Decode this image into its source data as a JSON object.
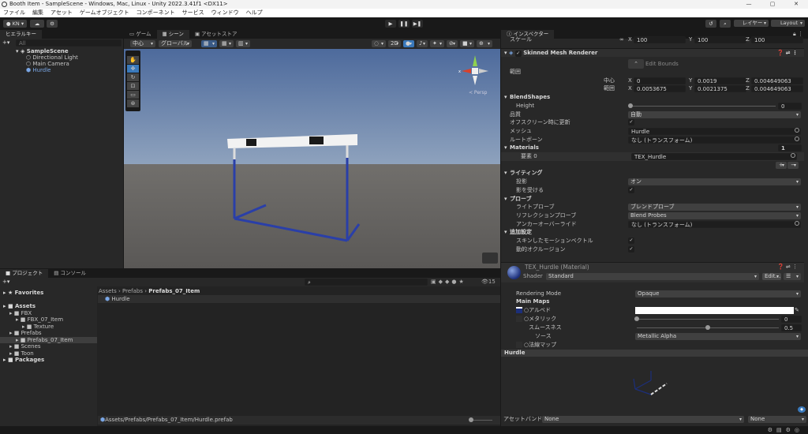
{
  "window": {
    "title": "Booth Item - SampleScene - Windows, Mac, Linux - Unity 2022.3.41f1 <DX11>",
    "controls": [
      "—",
      "▢",
      "✕"
    ]
  },
  "menu": [
    "ファイル",
    "編集",
    "アセット",
    "ゲームオブジェクト",
    "コンポーネント",
    "サービス",
    "ウィンドウ",
    "ヘルプ"
  ],
  "toolbar": {
    "account": "KN ▾",
    "play": "▶",
    "pause": "❚❚",
    "step": "▶❚",
    "layers": "レイヤー",
    "layout": "Layout"
  },
  "hierarchy": {
    "tab": "ヒエラルキー",
    "search_placeholder": "All",
    "scene": "SampleScene",
    "items": [
      "Directional Light",
      "Main Camera",
      "Hurdle"
    ]
  },
  "scene_tabs": [
    "ゲーム",
    "シーン",
    "アセットストア"
  ],
  "scene_toolbar": {
    "pivot": "中心",
    "space": "グローバル",
    "mode2d": "2D"
  },
  "gizmo": {
    "x": "x",
    "persp": "≺ Persp"
  },
  "project": {
    "tabs": [
      "プロジェクト",
      "コンソール"
    ],
    "count": "15",
    "tree": [
      {
        "label": "★ Favorites",
        "bold": true,
        "indent": 0
      },
      {
        "label": "Assets",
        "bold": true,
        "indent": 0
      },
      {
        "label": "FBX",
        "indent": 1
      },
      {
        "label": "FBX_07_Item",
        "indent": 2
      },
      {
        "label": "Texture",
        "indent": 3
      },
      {
        "label": "Prefabs",
        "indent": 1
      },
      {
        "label": "Prefabs_07_Item",
        "indent": 2,
        "selected": true
      },
      {
        "label": "Scenes",
        "indent": 1
      },
      {
        "label": "Toon",
        "indent": 1
      },
      {
        "label": "Packages",
        "bold": true,
        "indent": 0
      }
    ],
    "breadcrumb": [
      "Assets",
      "Prefabs",
      "Prefabs_07_Item"
    ],
    "files": [
      "Hurdle"
    ],
    "path": "Assets/Prefabs/Prefabs_07_Item/Hurdle.prefab"
  },
  "inspector": {
    "tab": "インスペクター",
    "scale": {
      "label": "スケール",
      "x": "100",
      "y": "100",
      "z": "100"
    },
    "component": "Skinned Mesh Renderer",
    "edit_bounds": "Edit Bounds",
    "rows": [
      {
        "type": "label",
        "label": "範囲"
      },
      {
        "type": "xyz",
        "label": "中心",
        "x": "0",
        "y": "0.0019",
        "z": "0.004649063"
      },
      {
        "type": "xyz",
        "label": "範囲",
        "x": "0.0053675",
        "y": "0.0021375",
        "z": "0.004649063"
      },
      {
        "type": "fold",
        "label": "BlendShapes"
      },
      {
        "type": "slider",
        "label": "Height",
        "value": "0",
        "fraction": 0,
        "indent": 1
      },
      {
        "type": "dd",
        "label": "品質",
        "value": "自動"
      },
      {
        "type": "check",
        "label": "オフスクリーン時に更新"
      },
      {
        "type": "obj",
        "label": "メッシュ",
        "value": "Hurdle"
      },
      {
        "type": "obj",
        "label": "ルートボーン",
        "value": "なし (トランスフォーム)"
      },
      {
        "type": "fold",
        "label": "Materials",
        "count": "1"
      },
      {
        "type": "elem",
        "label": "要素 0",
        "value": "TEX_Hurdle"
      },
      {
        "type": "plusminus",
        "plus": "+",
        "minus": "−"
      },
      {
        "type": "fold",
        "label": "ライティング"
      },
      {
        "type": "dd",
        "label": "投影",
        "value": "オン",
        "indent": 1
      },
      {
        "type": "check",
        "label": "影を受ける",
        "indent": 1
      },
      {
        "type": "fold",
        "label": "プローブ"
      },
      {
        "type": "dd",
        "label": "ライトプローブ",
        "value": "ブレンドプローブ",
        "indent": 1
      },
      {
        "type": "dd",
        "label": "リフレクションプローブ",
        "value": "Blend Probes",
        "indent": 1
      },
      {
        "type": "obj",
        "label": "アンカーオーバーライド",
        "value": "なし (トランスフォーム)",
        "indent": 1
      },
      {
        "type": "fold",
        "label": "追加設定"
      },
      {
        "type": "check",
        "label": "スキンしたモーションベクトル",
        "indent": 1
      },
      {
        "type": "check",
        "label": "動的オクルージョン",
        "indent": 1
      }
    ],
    "material": {
      "title": "TEX_Hurdle (Material)",
      "shader_label": "Shader",
      "shader": "Standard",
      "edit": "Edit...",
      "rendering_mode_label": "Rendering Mode",
      "rendering_mode": "Opaque",
      "main_maps": "Main Maps",
      "albedo": "○アルベド",
      "metallic": "○メタリック",
      "metallic_value": "0",
      "metallic_fraction": 0,
      "smoothness": "スムースネス",
      "smoothness_value": "0.5",
      "smoothness_fraction": 0.5,
      "source": "ソース",
      "source_value": "Metallic Alpha",
      "normal": "○法線マップ"
    },
    "preview_title": "Hurdle",
    "asset_bundle": {
      "label": "アセットバンドル",
      "value": "None",
      "variant": "None"
    }
  },
  "colors": {
    "accent": "#3a79bb",
    "sky_top": "#4d6a9c",
    "ground": "#5d5b59",
    "hurdle": "#2a3fa8"
  }
}
